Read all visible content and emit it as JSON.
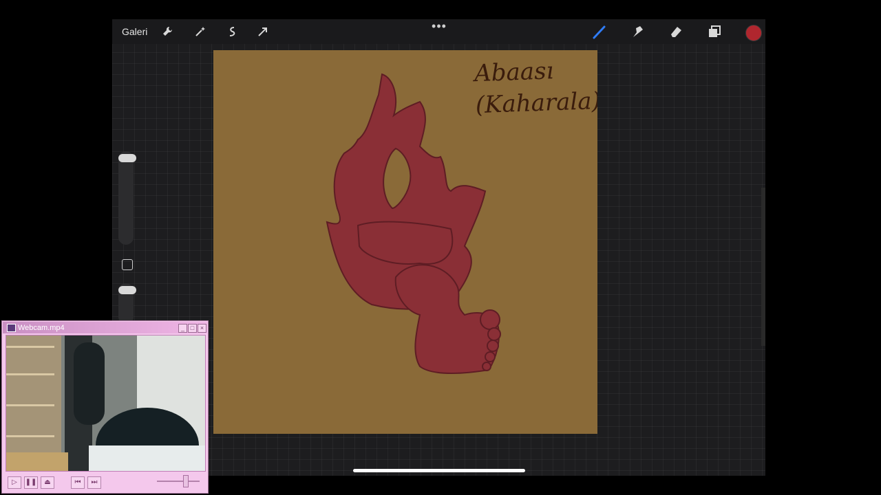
{
  "app": {
    "gallery_label": "Galeri",
    "toolbar_left_icons": [
      "wrench-icon",
      "magic-wand-icon",
      "selection-icon",
      "transform-arrow-icon"
    ],
    "toolbar_right_icons": [
      "brush-icon",
      "smudge-icon",
      "eraser-icon",
      "layers-icon"
    ],
    "more_label": "•••",
    "current_color": "#b0262e"
  },
  "canvas": {
    "background_color": "#8a6a38",
    "figure_color": "#8a2f36",
    "caption_line1": "Abaası",
    "caption_line2": "(Kaharala)"
  },
  "webcam": {
    "title": "Webcam.mp4",
    "minimize_label": "_",
    "maximize_label": "□",
    "close_label": "×",
    "controls": [
      {
        "name": "play",
        "label": "▷"
      },
      {
        "name": "pause",
        "label": "❚❚"
      },
      {
        "name": "eject",
        "label": "⏏"
      },
      {
        "name": "previous",
        "label": "⏮"
      },
      {
        "name": "next",
        "label": "⏭"
      }
    ]
  }
}
